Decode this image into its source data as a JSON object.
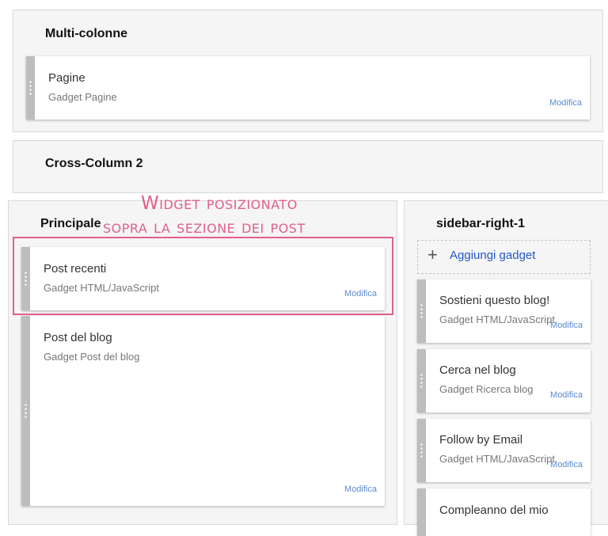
{
  "sections": {
    "multi_colonne": {
      "title": "Multi-colonne",
      "gadgets": [
        {
          "title": "Pagine",
          "subtitle": "Gadget Pagine",
          "edit": "Modifica"
        }
      ]
    },
    "cross_column_2": {
      "title": "Cross-Column 2"
    },
    "principale": {
      "title": "Principale",
      "gadgets": [
        {
          "title": "Post recenti",
          "subtitle": "Gadget HTML/JavaScript",
          "edit": "Modifica"
        },
        {
          "title": "Post del blog",
          "subtitle": "Gadget Post del blog",
          "edit": "Modifica"
        }
      ]
    },
    "sidebar_right_1": {
      "title": "sidebar-right-1",
      "add_gadget": "Aggiungi gadget",
      "gadgets": [
        {
          "title": "Sostieni questo blog!",
          "subtitle": "Gadget HTML/JavaScript",
          "edit": "Modifica"
        },
        {
          "title": "Cerca nel blog",
          "subtitle": "Gadget Ricerca blog",
          "edit": "Modifica"
        },
        {
          "title": "Follow by Email",
          "subtitle": "Gadget HTML/JavaScript",
          "edit": "Modifica"
        },
        {
          "title": "Compleanno del mio"
        }
      ]
    }
  },
  "annotation": {
    "line1": "Widget posizionato",
    "line2": "sopra la sezione dei post",
    "color": "#e0608a"
  }
}
